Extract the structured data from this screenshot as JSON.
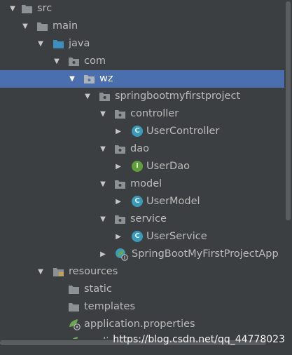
{
  "tree": {
    "src": "src",
    "main": "main",
    "java": "java",
    "com": "com",
    "wz": "wz",
    "springbootmyfirstproject": "springbootmyfirstproject",
    "controller": "controller",
    "UserController": "UserController",
    "dao": "dao",
    "UserDao": "UserDao",
    "model": "model",
    "UserModel": "UserModel",
    "service": "service",
    "UserService": "UserService",
    "SpringBootMyFirstProjectApp": "SpringBootMyFirstProjectApp",
    "resources": "resources",
    "static": "static",
    "templates": "templates",
    "application_properties": "application.properties",
    "application_truncated": "applicati"
  },
  "badges": {
    "class_letter": "C",
    "interface_letter": "I"
  },
  "watermark": "https://blog.csdn.net/qq_44778023",
  "colors": {
    "background": "#3c3f41",
    "selection": "#4b6eaf",
    "folder": "#8c9196",
    "source_folder": "#3d8fbd",
    "class_badge": "#3a9ab8",
    "interface_badge": "#5f9e3a",
    "spring_leaf": "#6aa84f"
  },
  "icons": {
    "folder": "folder-icon",
    "source_folder": "source-folder-icon",
    "package": "package-icon",
    "resources": "resources-folder-icon",
    "class": "class-icon",
    "interface": "interface-icon",
    "spring_boot": "spring-boot-app-icon",
    "spring_config": "spring-properties-icon"
  }
}
